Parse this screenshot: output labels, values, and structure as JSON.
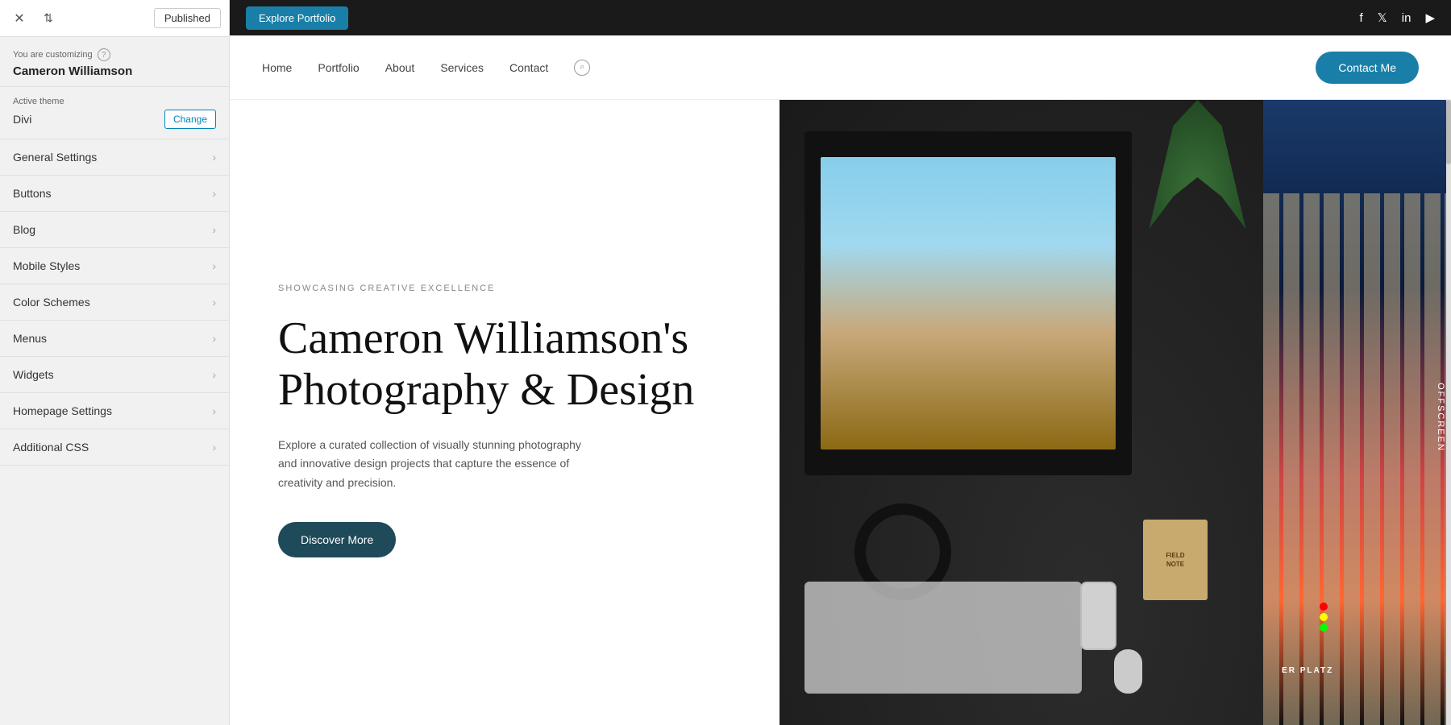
{
  "panel": {
    "topbar": {
      "published_label": "Published",
      "close_icon": "✕",
      "arrows_icon": "⇅"
    },
    "user_info": {
      "you_are_customizing": "You are customizing",
      "help_icon": "?",
      "site_name": "Cameron Williamson"
    },
    "active_theme": {
      "label": "Active theme",
      "theme_name": "Divi",
      "change_button": "Change"
    },
    "menu_items": [
      {
        "id": "general-settings",
        "label": "General Settings"
      },
      {
        "id": "buttons",
        "label": "Buttons"
      },
      {
        "id": "blog",
        "label": "Blog"
      },
      {
        "id": "mobile-styles",
        "label": "Mobile Styles"
      },
      {
        "id": "color-schemes",
        "label": "Color Schemes"
      },
      {
        "id": "menus",
        "label": "Menus"
      },
      {
        "id": "widgets",
        "label": "Widgets"
      },
      {
        "id": "homepage-settings",
        "label": "Homepage Settings"
      },
      {
        "id": "additional-css",
        "label": "Additional CSS"
      }
    ]
  },
  "site": {
    "topbar": {
      "explore_button": "Explore Portfolio",
      "social": {
        "facebook": "f",
        "twitter": "𝕏",
        "linkedin": "in",
        "youtube": "▶"
      }
    },
    "navbar": {
      "links": [
        "Home",
        "Portfolio",
        "About",
        "Services",
        "Contact"
      ],
      "contact_button": "Contact Me"
    },
    "hero": {
      "subtitle": "SHOWCASING CREATIVE EXCELLENCE",
      "title": "Cameron Williamson's Photography & Design",
      "description": "Explore a curated collection of visually stunning photography and innovative design projects that capture the essence of creativity and precision.",
      "cta_button": "Discover More",
      "notebook_line1": "FIELD",
      "notebook_line2": "NOTE",
      "offscreen_label": "Offscreen",
      "er_platz": "ER PLATZ"
    }
  }
}
